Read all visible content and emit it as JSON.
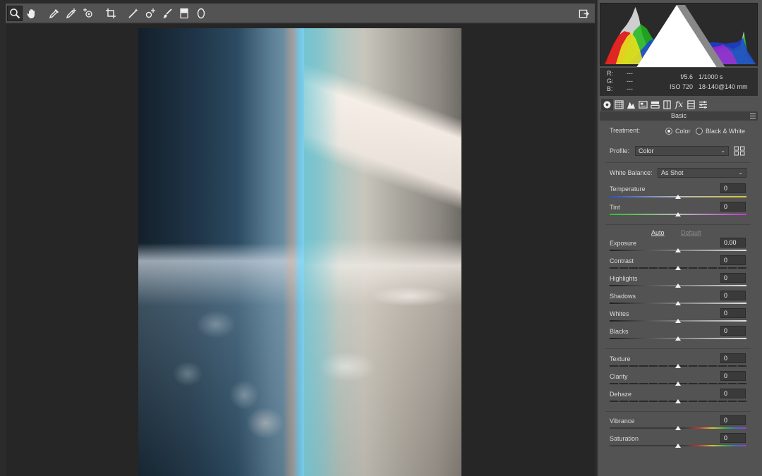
{
  "toolbar": {
    "tools": [
      {
        "name": "zoom-tool",
        "icon": "magnifier-icon",
        "active": true
      },
      {
        "name": "hand-tool",
        "icon": "hand-icon"
      },
      {
        "name": "white-balance-tool",
        "icon": "eyedropper-icon"
      },
      {
        "name": "color-sampler-tool",
        "icon": "eyedropper-plus-icon"
      },
      {
        "name": "targeted-adjustment-tool",
        "icon": "target-icon"
      },
      {
        "name": "crop-tool",
        "icon": "crop-icon"
      },
      {
        "name": "straighten-tool",
        "icon": "wand-icon"
      },
      {
        "name": "spot-removal-tool",
        "icon": "spot-icon"
      },
      {
        "name": "red-eye-tool",
        "icon": "redeye-icon"
      },
      {
        "name": "adjustment-brush-tool",
        "icon": "brush-icon"
      },
      {
        "name": "graduated-filter-tool",
        "icon": "graduated-icon"
      },
      {
        "name": "radial-filter-tool",
        "icon": "ellipse-icon"
      }
    ]
  },
  "readout": {
    "r_label": "R:",
    "r_value": "---",
    "g_label": "G:",
    "g_value": "---",
    "b_label": "B:",
    "b_value": "---",
    "aperture": "f/5.6",
    "shutter": "1/1000 s",
    "iso": "ISO 720",
    "lens": "18-140@140 mm"
  },
  "panel": {
    "section_title": "Basic",
    "treatment_label": "Treatment:",
    "treatment_color": "Color",
    "treatment_bw": "Black & White",
    "treatment_selected": "Color",
    "profile_label": "Profile:",
    "profile_value": "Color",
    "wb_label": "White Balance:",
    "wb_value": "As Shot",
    "auto_label": "Auto",
    "default_label": "Default"
  },
  "sliders": {
    "temperature": {
      "label": "Temperature",
      "value": "0"
    },
    "tint": {
      "label": "Tint",
      "value": "0"
    },
    "exposure": {
      "label": "Exposure",
      "value": "0.00"
    },
    "contrast": {
      "label": "Contrast",
      "value": "0"
    },
    "highlights": {
      "label": "Highlights",
      "value": "0"
    },
    "shadows": {
      "label": "Shadows",
      "value": "0"
    },
    "whites": {
      "label": "Whites",
      "value": "0"
    },
    "blacks": {
      "label": "Blacks",
      "value": "0"
    },
    "texture": {
      "label": "Texture",
      "value": "0"
    },
    "clarity": {
      "label": "Clarity",
      "value": "0"
    },
    "dehaze": {
      "label": "Dehaze",
      "value": "0"
    },
    "vibrance": {
      "label": "Vibrance",
      "value": "0"
    },
    "saturation": {
      "label": "Saturation",
      "value": "0"
    }
  },
  "colors": {
    "panel_bg": "#535353",
    "canvas_bg": "#262626",
    "toolbar_bg": "#535353"
  }
}
